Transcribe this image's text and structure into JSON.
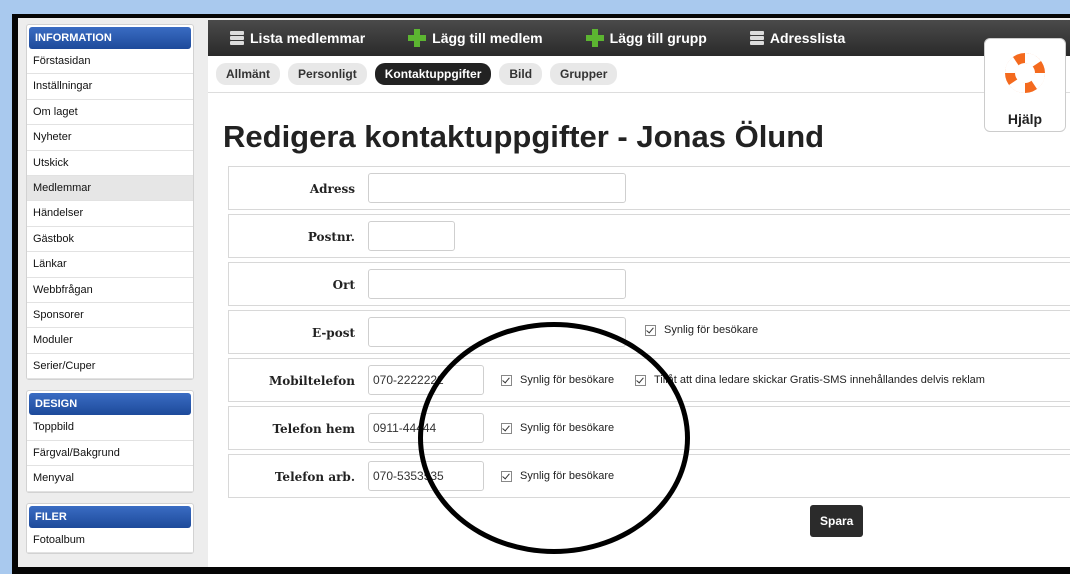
{
  "sidebar": {
    "information": {
      "heading": "INFORMATION",
      "items": [
        "Förstasidan",
        "Inställningar",
        "Om laget",
        "Nyheter",
        "Utskick",
        "Medlemmar",
        "Händelser",
        "Gästbok",
        "Länkar",
        "Webbfrågan",
        "Sponsorer",
        "Moduler",
        "Serier/Cuper"
      ],
      "active": "Medlemmar"
    },
    "design": {
      "heading": "DESIGN",
      "items": [
        "Toppbild",
        "Färgval/Bakgrund",
        "Menyval"
      ]
    },
    "filer": {
      "heading": "FILER",
      "items": [
        "Fotoalbum"
      ]
    }
  },
  "topnav": {
    "list_members": "Lista medlemmar",
    "add_member": "Lägg till medlem",
    "add_group": "Lägg till grupp",
    "address_list": "Adresslista"
  },
  "tabs": [
    "Allmänt",
    "Personligt",
    "Kontaktuppgifter",
    "Bild",
    "Grupper"
  ],
  "active_tab": "Kontaktuppgifter",
  "help_label": "Hjälp",
  "page_title": "Redigera kontaktuppgifter - Jonas Ölund",
  "form": {
    "address_label": "Adress",
    "address_value": "",
    "postnr_label": "Postnr.",
    "postnr_value": "",
    "ort_label": "Ort",
    "ort_value": "",
    "email_label": "E-post",
    "email_value": "",
    "email_visible": "Synlig för besökare",
    "mobile_label": "Mobiltelefon",
    "mobile_value": "070-2222222",
    "mobile_visible": "Synlig för besökare",
    "mobile_sms": "Tillåt att dina ledare skickar Gratis-SMS innehållandes delvis reklam",
    "home_label": "Telefon hem",
    "home_value": "0911-44444",
    "home_visible": "Synlig för besökare",
    "work_label": "Telefon arb.",
    "work_value": "070-5353535",
    "work_visible": "Synlig för besökare"
  },
  "save_label": "Spara"
}
